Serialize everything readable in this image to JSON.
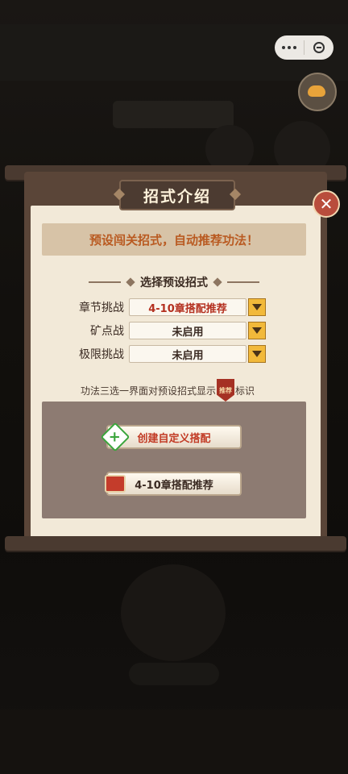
{
  "dialog": {
    "title": "招式介绍",
    "notice": "预设闯关招式，自动推荐功法！",
    "section_title": "选择预设招式",
    "presets": [
      {
        "label": "章节挑战",
        "value": "4-10章搭配推荐"
      },
      {
        "label": "矿点战",
        "value": "未启用"
      },
      {
        "label": "极限挑战",
        "value": "未启用"
      }
    ],
    "tip_before": "功法三选一界面对预设招式显示",
    "tip_badge": "推荐",
    "tip_after": "标识",
    "create_button": "创建自定义搭配",
    "recommend_button": "4-10章搭配推荐"
  },
  "icons": {
    "close": "close-icon",
    "more": "more-dots-icon",
    "exit": "exit-circle-icon",
    "add": "plus-icon",
    "scroll": "scroll-icon"
  },
  "colors": {
    "accent_text": "#b4301f",
    "notice_text": "#b95a21",
    "dropdown": "#f2b93a"
  }
}
